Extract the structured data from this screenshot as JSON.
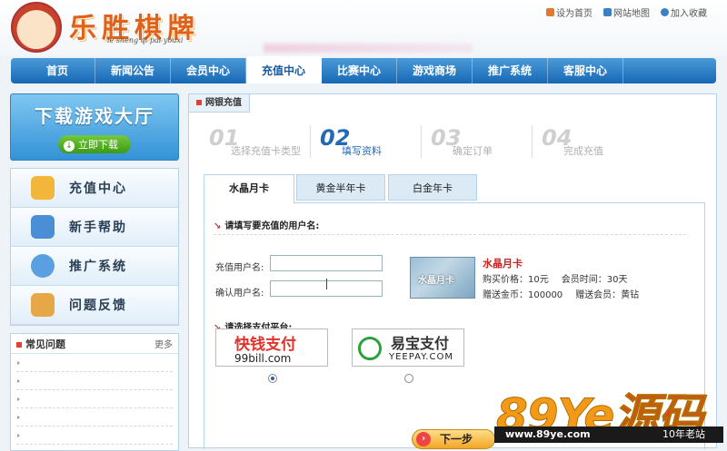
{
  "site": {
    "logo_text": "乐胜棋牌",
    "logo_sub": "le sheng qi pai youxi",
    "toplinks": [
      "设为首页",
      "网站地图",
      "加入收藏"
    ]
  },
  "nav": [
    "首页",
    "新闻公告",
    "会员中心",
    "充值中心",
    "比赛中心",
    "游戏商场",
    "推广系统",
    "客服中心"
  ],
  "nav_active": 3,
  "left": {
    "download_title": "下载游戏大厅",
    "download_btn": "立即下载",
    "menu": [
      {
        "label": "充值中心",
        "icon": "coins-icon",
        "color": "#f1b63a"
      },
      {
        "label": "新手帮助",
        "icon": "book-icon",
        "color": "#4a8fd6"
      },
      {
        "label": "推广系统",
        "icon": "user-icon",
        "color": "#5aa0e0"
      },
      {
        "label": "问题反馈",
        "icon": "mail-icon",
        "color": "#e6a847"
      }
    ],
    "faq_title": "常见问题",
    "faq_more": "更多"
  },
  "main": {
    "tab_title": "网银充值",
    "steps": [
      {
        "num": "01",
        "label": "选择充值卡类型"
      },
      {
        "num": "02",
        "label": "填写资料"
      },
      {
        "num": "03",
        "label": "确定订单"
      },
      {
        "num": "04",
        "label": "完成充值"
      }
    ],
    "active_step": 1,
    "card_tabs": [
      "水晶月卡",
      "黄金半年卡",
      "白金年卡"
    ],
    "section_user": "请填写要充值的用户名:",
    "field_user": "充值用户名:",
    "field_confirm": "确认用户名:",
    "user_value": "",
    "confirm_value": "",
    "card_image_text": "水晶月卡",
    "card_title": "水晶月卡",
    "card_price_label": "购买价格：10元",
    "card_time_label": "会员时间：30天",
    "card_gold_label": "赠送金币：100000",
    "card_member_label": "赠送会员：黄钻",
    "section_pay": "请选择支付平台:",
    "pay": [
      {
        "name": "快钱支付",
        "domain": "99bill.com",
        "selected": true
      },
      {
        "name": "易宝支付",
        "domain": "YEEPAY.COM",
        "selected": false
      }
    ],
    "next_btn": "下一步"
  },
  "watermark": {
    "big": "89Ye",
    "big2": "源码",
    "url": "www.89ye.com",
    "tag": "10年老站"
  }
}
